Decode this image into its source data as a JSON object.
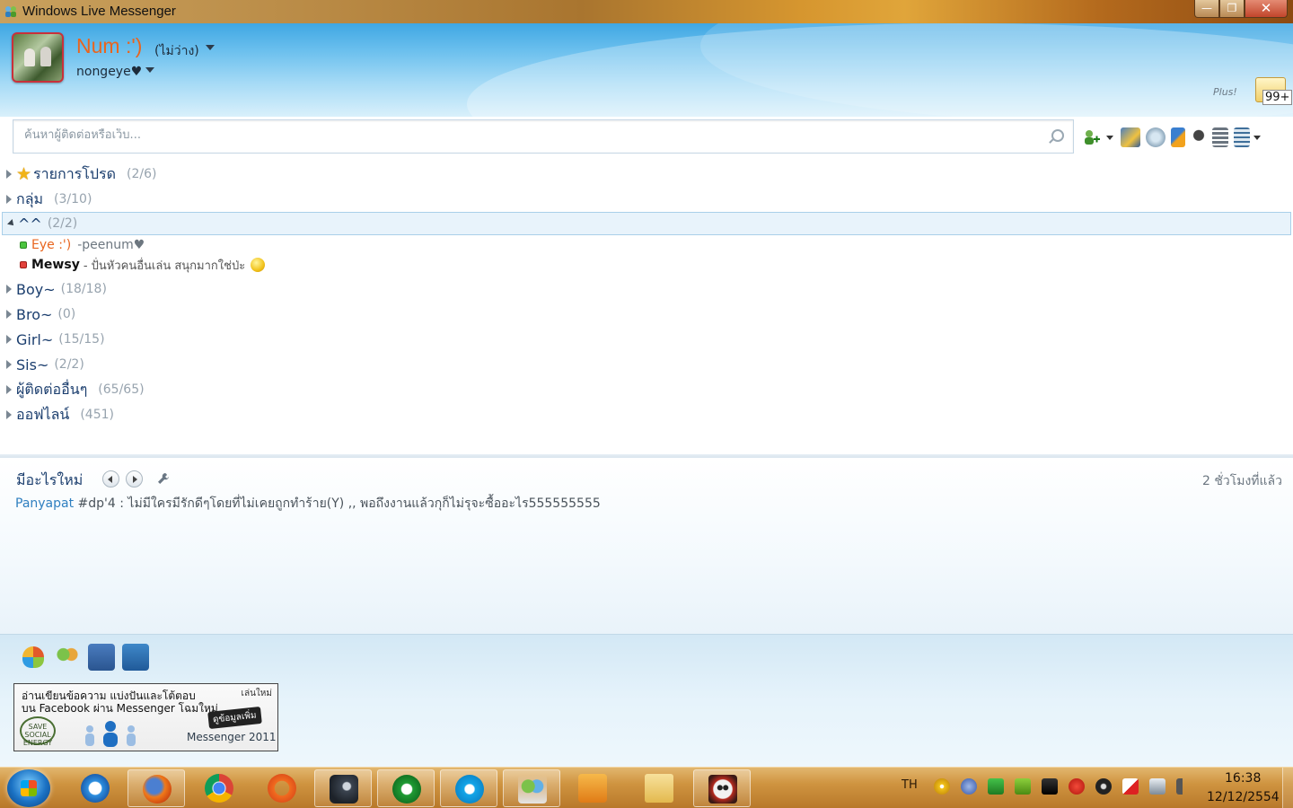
{
  "window": {
    "title": "Windows Live Messenger",
    "controls": {
      "minimize": "—",
      "maximize": "❐",
      "close": "✕"
    }
  },
  "header": {
    "display_name": "Num :')",
    "status": "(ไม่ว่าง)",
    "personal_message": "nongeye♥",
    "plus_label": "Plus!",
    "mail_count": "99+"
  },
  "search": {
    "placeholder": "ค้นหาผู้ติดต่อหรือเว็บ..."
  },
  "toolbar": {
    "icons": [
      "add-contact-icon",
      "change-picture-icon",
      "games-icon",
      "activities-icon",
      "menu-icon",
      "layout-icon",
      "options-icon"
    ]
  },
  "groups": [
    {
      "name": "รายการโปรด",
      "count": "(2/6)"
    },
    {
      "name": "กลุ่ม",
      "count": "(3/10)"
    },
    {
      "name": "^^",
      "count": "(2/2)"
    },
    {
      "name": "Boy~",
      "count": "(18/18)"
    },
    {
      "name": "Bro~",
      "count": "(0)"
    },
    {
      "name": "Girl~",
      "count": "(15/15)"
    },
    {
      "name": "Sis~",
      "count": "(2/2)"
    },
    {
      "name": "ผู้ติดต่ออื่นๆ",
      "count": "(65/65)"
    },
    {
      "name": "ออฟไลน์",
      "count": "(451)"
    }
  ],
  "contacts": [
    {
      "name": "Eye :')",
      "message": "-peenum♥",
      "status_color": "#4bc43f"
    },
    {
      "name": "Mewsy",
      "message": "- ปั่นหัวคนอื่นเล่น สนุกมากใช่ป่ะ",
      "status_color": "#e2413b"
    }
  ],
  "whats_new": {
    "title": "มีอะไรใหม่",
    "time": "2 ชั่วโมงที่แล้ว",
    "author": "Panyapat",
    "text": " #dp'4 : ไม่มีใครมีรักดีๆโดยที่ไม่เคยถูกทำร้าย(Y) ,, พอถึงงานแล้วกุก็ไม่รุจะซื้ออะไร555555555"
  },
  "ad": {
    "line1": "อ่านเขียนข้อความ แบ่งปันและโต้ตอบ",
    "line2": "บน Facebook ผ่าน Messenger โฉมใหม่",
    "new_label": "เล่นใหม่",
    "button": "ดูข้อมูลเพิ่ม",
    "badge": "SAVE SOCIAL ENERGY",
    "brand": "Messenger 2011"
  },
  "taskbar": {
    "language": "TH",
    "time": "16:38",
    "date": "12/12/2554"
  }
}
